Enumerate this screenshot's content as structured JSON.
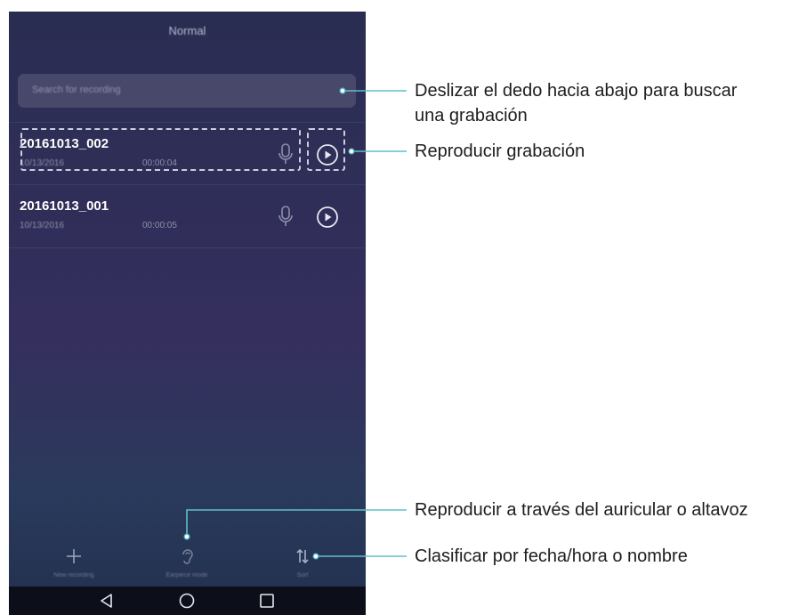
{
  "header": {
    "title": "Normal"
  },
  "search": {
    "placeholder": "Search for recording"
  },
  "recordings": [
    {
      "name": "20161013_002",
      "date": "10/13/2016",
      "duration": "00:00:04"
    },
    {
      "name": "20161013_001",
      "date": "10/13/2016",
      "duration": "00:00:05"
    }
  ],
  "bottom_bar": {
    "new_recording": "New recording",
    "earpiece_mode": "Earpiece mode",
    "sort": "Sort"
  },
  "callouts": {
    "search": "Deslizar el dedo hacia abajo para buscar una grabación",
    "play": "Reproducir grabación",
    "earpiece": "Reproducir a través del auricular o altavoz",
    "sort": "Clasificar por fecha/hora o nombre"
  },
  "colors": {
    "background_top": "#2a2d52",
    "background_bottom": "#22304e",
    "callout_line": "#5fbfc9",
    "dashed_highlight": "#c9cedd"
  },
  "icons": [
    "mic-icon",
    "play-icon",
    "plus-icon",
    "ear-icon",
    "sort-icon",
    "back-icon",
    "home-icon",
    "recents-icon"
  ]
}
